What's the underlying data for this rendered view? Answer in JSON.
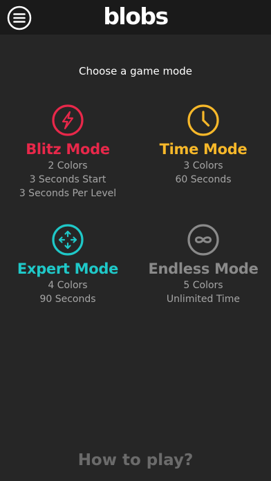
{
  "header": {
    "logo_text": "blobs",
    "menu_icon": "hamburger-menu-icon"
  },
  "prompt": "Choose a game mode",
  "colors": {
    "background": "#262626",
    "header": "#1a1a1a",
    "blitz": "#e8284a",
    "time": "#f7b82a",
    "expert": "#1fc8c8",
    "endless": "#8a8a8a",
    "detail_text": "#a6a6a6"
  },
  "modes": {
    "blitz": {
      "title": "Blitz Mode",
      "icon": "lightning-bolt-icon",
      "lines": [
        "2 Colors",
        "3 Seconds Start",
        "3 Seconds Per Level"
      ]
    },
    "time": {
      "title": "Time Mode",
      "icon": "clock-icon",
      "lines": [
        "3 Colors",
        "60 Seconds"
      ]
    },
    "expert": {
      "title": "Expert Mode",
      "icon": "four-arrows-icon",
      "lines": [
        "4 Colors",
        "90 Seconds"
      ]
    },
    "endless": {
      "title": "Endless Mode",
      "icon": "infinity-icon",
      "lines": [
        "5 Colors",
        "Unlimited Time"
      ]
    }
  },
  "footer": {
    "how_to_play": "How to play?"
  }
}
